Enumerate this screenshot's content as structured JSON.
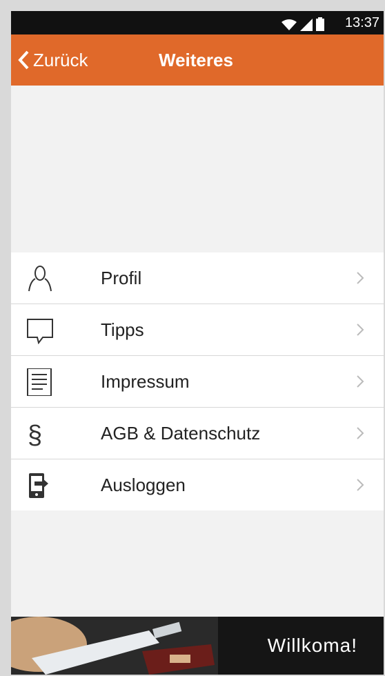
{
  "status_bar": {
    "time": "13:37",
    "icons": [
      "wifi-icon",
      "signal-icon",
      "battery-icon"
    ]
  },
  "header": {
    "back_label": "Zurück",
    "title": "Weiteres"
  },
  "menu": {
    "items": [
      {
        "label": "Profil",
        "icon": "person-icon"
      },
      {
        "label": "Tipps",
        "icon": "speech-bubble-icon"
      },
      {
        "label": "Impressum",
        "icon": "document-icon"
      },
      {
        "label": "AGB & Datenschutz",
        "icon": "paragraph-icon"
      },
      {
        "label": "Ausloggen",
        "icon": "logout-icon"
      }
    ]
  },
  "banner": {
    "text": "Willkoma!"
  },
  "colors": {
    "accent": "#e0692a",
    "status_bar": "#111111",
    "background": "#f2f2f2"
  }
}
